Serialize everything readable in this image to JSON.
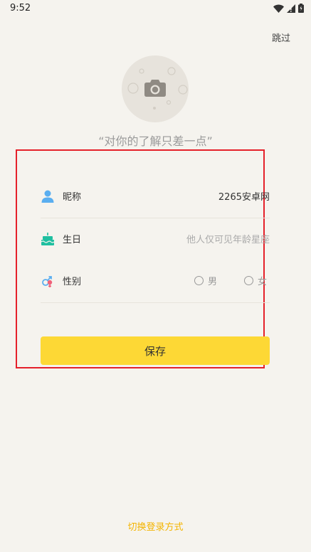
{
  "status_bar": {
    "time": "9:52"
  },
  "header": {
    "skip_label": "跳过"
  },
  "profile": {
    "tagline": "“对你的了解只差一点”"
  },
  "form": {
    "nickname": {
      "label": "昵称",
      "value": "2265安卓网"
    },
    "birthday": {
      "label": "生日",
      "placeholder": "他人仅可见年龄星座"
    },
    "gender": {
      "label": "性别",
      "options": [
        "男",
        "女"
      ]
    }
  },
  "actions": {
    "save_label": "保存",
    "switch_login_label": "切换登录方式"
  },
  "colors": {
    "accent": "#fdd835",
    "link": "#f4b400",
    "highlight": "#e5202a",
    "user_icon": "#5aaef0",
    "cake_icon": "#1fbfa0"
  }
}
